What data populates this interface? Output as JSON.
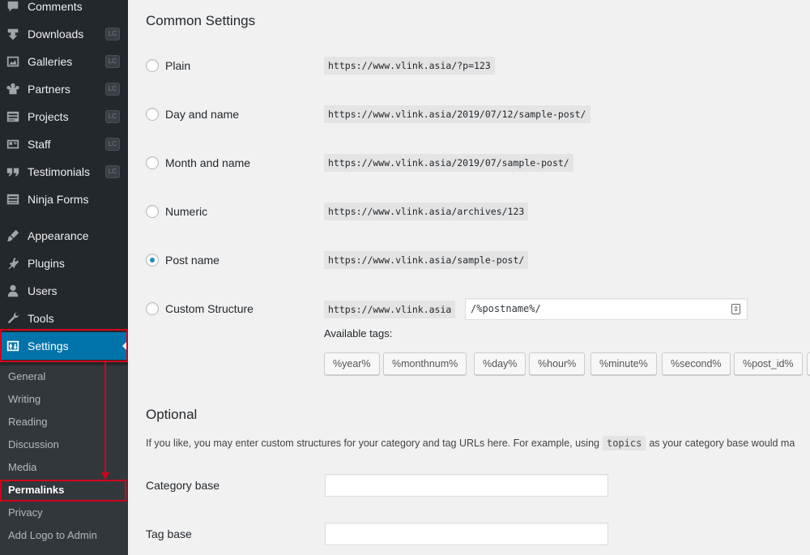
{
  "sidebar": {
    "menu": [
      {
        "label": "Comments",
        "icon": "comments-icon",
        "badge": ""
      },
      {
        "label": "Downloads",
        "icon": "downloads-icon",
        "badge": "LC"
      },
      {
        "label": "Galleries",
        "icon": "galleries-icon",
        "badge": "LC"
      },
      {
        "label": "Partners",
        "icon": "partners-icon",
        "badge": "LC"
      },
      {
        "label": "Projects",
        "icon": "projects-icon",
        "badge": "LC"
      },
      {
        "label": "Staff",
        "icon": "staff-icon",
        "badge": "LC"
      },
      {
        "label": "Testimonials",
        "icon": "testimonials-icon",
        "badge": "LC"
      },
      {
        "label": "Ninja Forms",
        "icon": "forms-icon",
        "badge": ""
      },
      {
        "label": "Appearance",
        "icon": "appearance-icon",
        "badge": ""
      },
      {
        "label": "Plugins",
        "icon": "plugins-icon",
        "badge": ""
      },
      {
        "label": "Users",
        "icon": "users-icon",
        "badge": ""
      },
      {
        "label": "Tools",
        "icon": "tools-icon",
        "badge": ""
      },
      {
        "label": "Settings",
        "icon": "settings-icon",
        "badge": ""
      }
    ],
    "submenu": [
      "General",
      "Writing",
      "Reading",
      "Discussion",
      "Media",
      "Permalinks",
      "Privacy",
      "Add Logo to Admin"
    ],
    "active_submenu": "Permalinks",
    "colors": {
      "sidebar_bg": "#23282d",
      "submenu_bg": "#32373c",
      "current_bg": "#0073aa",
      "highlight": "#d0021b"
    }
  },
  "main": {
    "common_title": "Common Settings",
    "options": [
      {
        "label": "Plain",
        "example": "https://www.vlink.asia/?p=123",
        "checked": false
      },
      {
        "label": "Day and name",
        "example": "https://www.vlink.asia/2019/07/12/sample-post/",
        "checked": false
      },
      {
        "label": "Month and name",
        "example": "https://www.vlink.asia/2019/07/sample-post/",
        "checked": false
      },
      {
        "label": "Numeric",
        "example": "https://www.vlink.asia/archives/123",
        "checked": false
      },
      {
        "label": "Post name",
        "example": "https://www.vlink.asia/sample-post/",
        "checked": true
      },
      {
        "label": "Custom Structure",
        "example": "https://www.vlink.asia",
        "checked": false
      }
    ],
    "custom_structure_value": "/%postname%/",
    "available_tags_label": "Available tags:",
    "tags": [
      "%year%",
      "%monthnum%",
      "%day%",
      "%hour%",
      "%minute%",
      "%second%",
      "%post_id%"
    ],
    "optional_title": "Optional",
    "optional_desc_before": "If you like, you may enter custom structures for your category and tag URLs here. For example, using",
    "optional_desc_code": "topics",
    "optional_desc_after": "as your category base would ma",
    "category_base_label": "Category base",
    "category_base_value": "",
    "tag_base_label": "Tag base",
    "tag_base_value": ""
  }
}
